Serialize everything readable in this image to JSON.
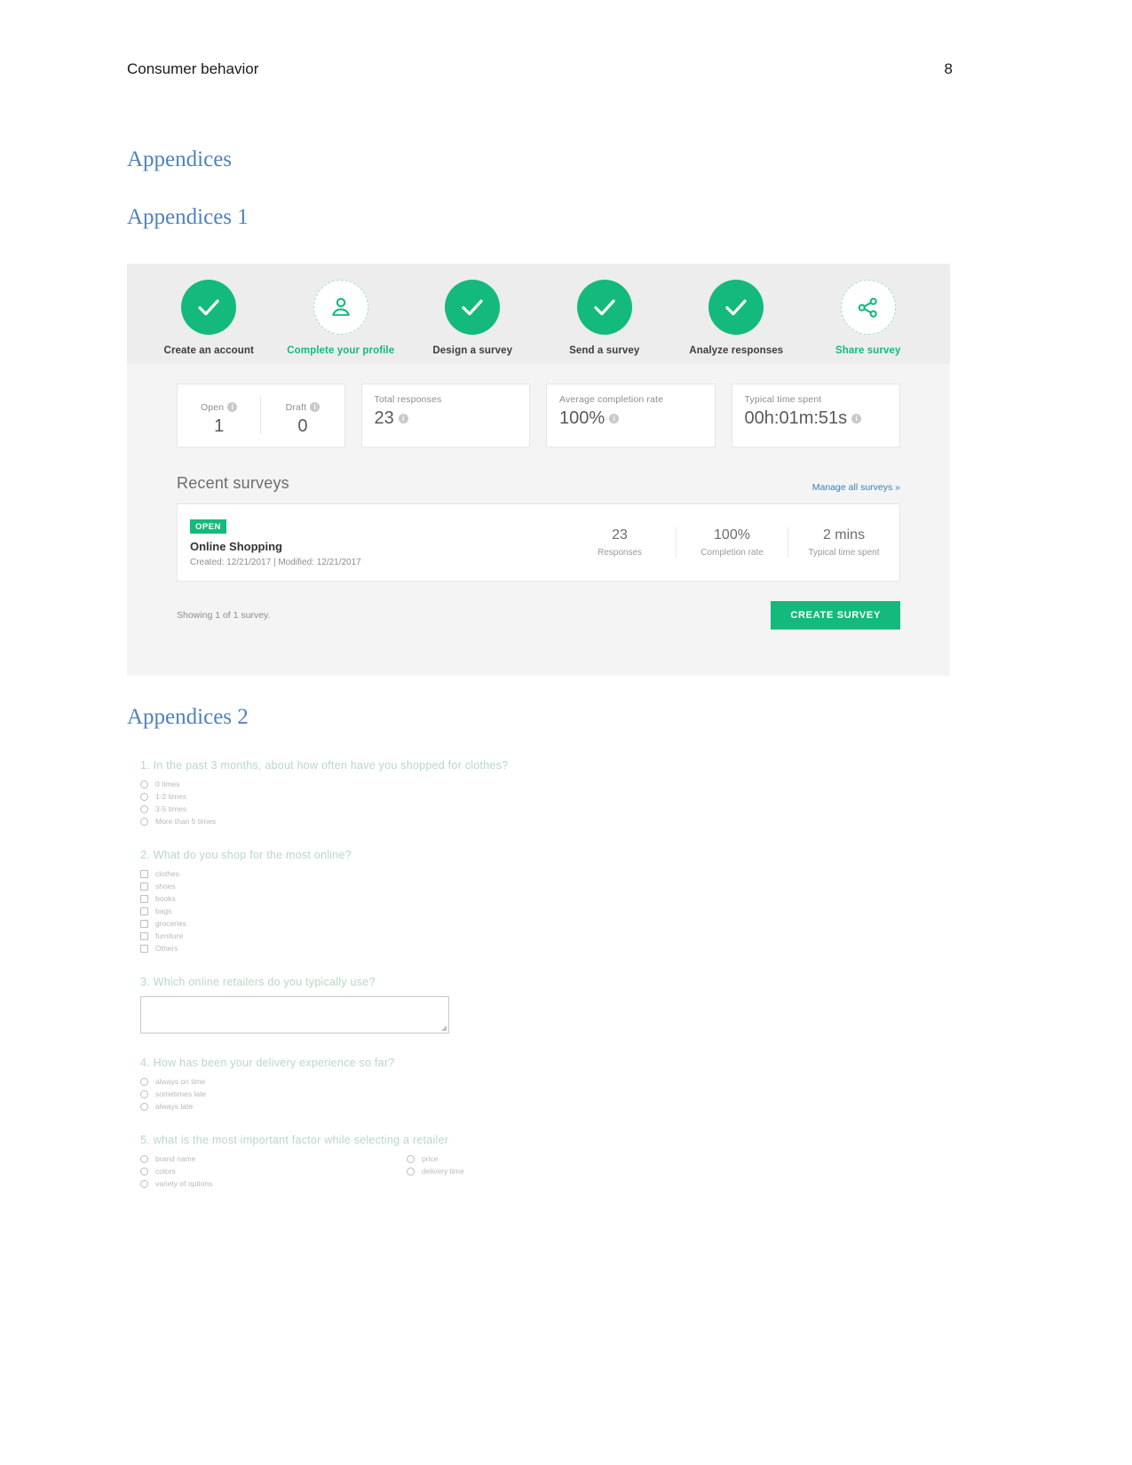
{
  "document": {
    "header_title": "Consumer behavior",
    "page_number": "8",
    "headings": {
      "appendices": "Appendices",
      "appendix_1": "Appendices 1",
      "appendix_2": "Appendices 2"
    }
  },
  "colors": {
    "brand_green": "#13ba7c",
    "heading_blue": "#4f81bd",
    "link_blue": "#3b7fb5",
    "question_green": "#b6d9c4"
  },
  "dashboard": {
    "stepper": [
      {
        "label": "Create an account",
        "icon": "check-icon",
        "state": "done"
      },
      {
        "label": "Complete your profile",
        "icon": "profile-icon",
        "state": "todo"
      },
      {
        "label": "Design a survey",
        "icon": "check-icon",
        "state": "done"
      },
      {
        "label": "Send a survey",
        "icon": "check-icon",
        "state": "done"
      },
      {
        "label": "Analyze responses",
        "icon": "check-icon",
        "state": "done"
      },
      {
        "label": "Share survey",
        "icon": "share-icon",
        "state": "todo"
      }
    ],
    "stats": {
      "open_label": "Open",
      "open_value": "1",
      "draft_label": "Draft",
      "draft_value": "0",
      "total_responses_label": "Total responses",
      "total_responses_value": "23",
      "avg_completion_label": "Average completion rate",
      "avg_completion_value": "100%",
      "typical_time_label": "Typical time spent",
      "typical_time_value": "00h:01m:51s"
    },
    "recent": {
      "title": "Recent surveys",
      "manage_link": "Manage all surveys »",
      "survey": {
        "status_badge": "OPEN",
        "name": "Online Shopping",
        "dates": "Created: 12/21/2017   |   Modified: 12/21/2017",
        "metrics": [
          {
            "value": "23",
            "label": "Responses"
          },
          {
            "value": "100%",
            "label": "Completion rate"
          },
          {
            "value": "2 mins",
            "label": "Typical time spent"
          }
        ]
      },
      "showing_text": "Showing 1 of 1 survey.",
      "create_button": "CREATE SURVEY"
    }
  },
  "survey_form": {
    "questions": [
      {
        "text": "1. In the past 3 months, about how often have you shopped for clothes?",
        "type": "radio",
        "layout": "single",
        "options": [
          "0 times",
          "1-2 times",
          "3-5 times",
          "More than 5 times"
        ]
      },
      {
        "text": "2. What do you shop for the most online?",
        "type": "checkbox",
        "layout": "single",
        "options": [
          "clothes",
          "shoes",
          "books",
          "bags",
          "groceries",
          "furniture",
          "Others"
        ]
      },
      {
        "text": "3. Which online retailers do you typically use?",
        "type": "textarea",
        "layout": "single",
        "value": "",
        "options": []
      },
      {
        "text": "4. How has been your delivery experience so far?",
        "type": "radio",
        "layout": "single",
        "options": [
          "always on time",
          "sometimes late",
          "always late"
        ]
      },
      {
        "text": "5. what is the most important factor while selecting a retailer",
        "type": "radio",
        "layout": "two-column",
        "options_left": [
          "brand name",
          "colors",
          "variety of options"
        ],
        "options_right": [
          "price",
          "delivery time"
        ]
      }
    ]
  }
}
